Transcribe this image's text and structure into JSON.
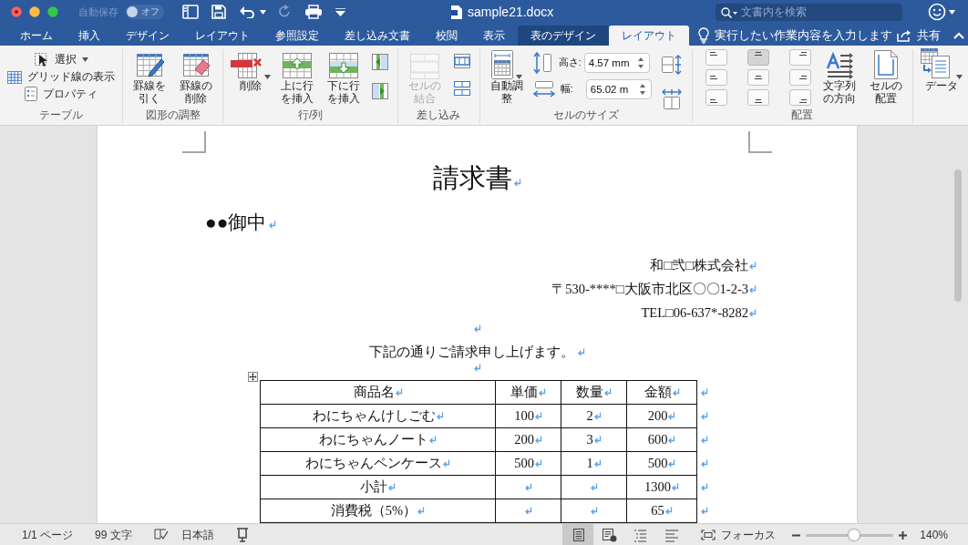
{
  "title_bar": {
    "autosave": {
      "label": "自動保存",
      "state_label": "オフ",
      "on": false
    },
    "file_name": "sample21.docx",
    "search": {
      "placeholder": "文書内を検索"
    }
  },
  "tabs": [
    {
      "label": "ホーム",
      "selected": false,
      "kind": "standard"
    },
    {
      "label": "挿入",
      "selected": false,
      "kind": "standard"
    },
    {
      "label": "デザイン",
      "selected": false,
      "kind": "standard"
    },
    {
      "label": "レイアウト",
      "selected": false,
      "kind": "standard"
    },
    {
      "label": "参照設定",
      "selected": false,
      "kind": "standard"
    },
    {
      "label": "差し込み文書",
      "selected": false,
      "kind": "standard"
    },
    {
      "label": "校閲",
      "selected": false,
      "kind": "standard"
    },
    {
      "label": "表示",
      "selected": false,
      "kind": "standard"
    },
    {
      "label": "表のデザイン",
      "selected": false,
      "kind": "contextual"
    },
    {
      "label": "レイアウト",
      "selected": true,
      "kind": "contextual"
    }
  ],
  "tell_me": {
    "placeholder": "実行したい作業内容を入力します"
  },
  "share": {
    "label": "共有"
  },
  "ribbon": {
    "groups": [
      {
        "label": "テーブル",
        "controls": [
          {
            "kind": "select",
            "label": "選択",
            "disabled": false
          },
          {
            "kind": "gridlines",
            "label": "グリッド線の表示",
            "disabled": false
          },
          {
            "kind": "properties",
            "label": "プロパティ",
            "disabled": false
          }
        ]
      },
      {
        "label": "図形の調整",
        "controls": [
          {
            "kind": "drawtable",
            "label": "罫線を引く",
            "disabled": false
          },
          {
            "kind": "eraser",
            "label": "罫線の削除",
            "disabled": false
          }
        ]
      },
      {
        "label": "行/列",
        "controls": [
          {
            "kind": "delete",
            "label": "削除",
            "disabled": false
          },
          {
            "kind": "insertabove",
            "label": "上に行を挿入",
            "disabled": false
          },
          {
            "kind": "insertbelow",
            "label": "下に行を挿入",
            "disabled": false
          },
          {
            "kind": "insertleft",
            "disabled": false
          },
          {
            "kind": "insertright",
            "disabled": false
          }
        ]
      },
      {
        "label": "差し込み",
        "controls": [
          {
            "kind": "merge",
            "label": "セルの結合",
            "disabled": true
          },
          {
            "kind": "splitcells",
            "disabled": false
          },
          {
            "kind": "splittable",
            "disabled": false
          }
        ]
      },
      {
        "label": "セルのサイズ",
        "controls": [
          {
            "kind": "autofit",
            "label": "自動調整",
            "disabled": false
          },
          {
            "kind": "height",
            "label": "高さ:",
            "value": "4.57 mm"
          },
          {
            "kind": "width",
            "label": "幅:",
            "value": "65.02 m"
          },
          {
            "kind": "distributerows",
            "disabled": false
          },
          {
            "kind": "distributecols",
            "disabled": false
          }
        ]
      },
      {
        "label": "配置",
        "controls": [
          {
            "kind": "alignment",
            "options": [
              {
                "kind": "top-left",
                "selected": false
              },
              {
                "kind": "top-center",
                "selected": true
              },
              {
                "kind": "top-right",
                "selected": false
              },
              {
                "kind": "middle-left",
                "selected": false
              },
              {
                "kind": "middle-center",
                "selected": false
              },
              {
                "kind": "middle-right",
                "selected": false
              },
              {
                "kind": "bottom-left",
                "selected": false
              },
              {
                "kind": "bottom-center",
                "selected": false
              },
              {
                "kind": "bottom-right",
                "selected": false
              }
            ]
          },
          {
            "kind": "textdirection",
            "label": "文字列の方向",
            "disabled": false
          },
          {
            "kind": "cellmargins",
            "label": "セルの配置",
            "disabled": false
          }
        ]
      },
      {
        "controls": [
          {
            "kind": "data",
            "label": "データ",
            "disabled": false
          }
        ]
      }
    ]
  },
  "document": {
    "show_marks": true,
    "title": "請求書",
    "addressee": "●●御中",
    "sender_lines": [
      "和□弐□株式会社",
      "〒530-****□大阪市北区〇〇1-2-3",
      "TEL□06-637*-8282"
    ],
    "intro": "下記の通りご請求申し上げます。",
    "table": {
      "columns": [
        "商品名",
        "単価",
        "数量",
        "金額"
      ],
      "rows": [
        {
          "item": "わにちゃんけしごむ",
          "unit_price": "100",
          "quantity": "2",
          "amount": "200"
        },
        {
          "item": "わにちゃんノート",
          "unit_price": "200",
          "quantity": "3",
          "amount": "600"
        },
        {
          "item": "わにちゃんペンケース",
          "unit_price": "500",
          "quantity": "1",
          "amount": "500"
        },
        {
          "item": "小計",
          "amount": "1300"
        },
        {
          "item": "消費税（5%）",
          "amount": "65"
        }
      ]
    }
  },
  "status_bar": {
    "page": "1/1 ページ",
    "words": "99 文字",
    "language": "日本語",
    "views": [
      {
        "kind": "print",
        "selected": true
      },
      {
        "kind": "web",
        "selected": false
      },
      {
        "kind": "outline",
        "selected": false
      },
      {
        "kind": "draft",
        "selected": false
      }
    ],
    "focus": "フォーカス",
    "zoom": {
      "level": 0.55,
      "label": "140%"
    }
  }
}
